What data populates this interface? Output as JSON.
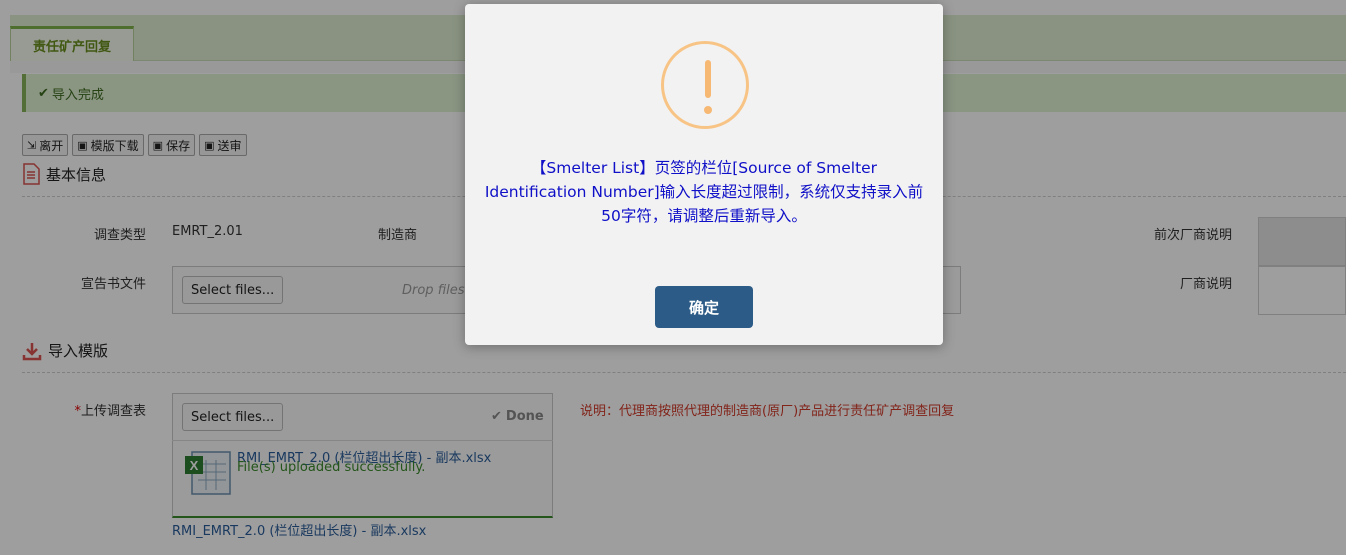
{
  "tabs": [
    {
      "label": "责任矿产回复"
    }
  ],
  "notice": {
    "text": "导入完成"
  },
  "toolbar": {
    "leave": "离开",
    "template_download": "模版下载",
    "save": "保存",
    "submit": "送审"
  },
  "basic_info": {
    "title": "基本信息",
    "survey_type_label": "调查类型",
    "survey_type_value": "EMRT_2.01",
    "manufacturer_label": "制造商",
    "prev_vendor_note_label": "前次厂商说明",
    "declaration_label": "宣告书文件",
    "vendor_note_label": "厂商说明",
    "select_files": "Select files...",
    "drop_hint": "Drop files h"
  },
  "import": {
    "title": "导入模版",
    "upload_label": "上传调查表",
    "required_mark": "*",
    "select_files": "Select files...",
    "done": "Done",
    "file_name": "RMI_EMRT_2.0 (栏位超出长度) - 副本.xlsx",
    "file_status": "File(s) uploaded successfully.",
    "bottom_link": "RMI_EMRT_2.0 (栏位超出长度) - 副本.xlsx",
    "note": "说明：代理商按照代理的制造商(原厂)产品进行责任矿产调查回复"
  },
  "modal": {
    "message": "【Smelter List】页签的栏位[Source of Smelter Identification Number]输入长度超过限制，系统仅支持录入前50字符，请调整后重新导入。",
    "ok": "确定"
  },
  "colors": {
    "accent_green": "#7fb24a",
    "modal_button": "#2b5b86",
    "warning": "#f6b873",
    "message_blue": "#1010c8"
  }
}
